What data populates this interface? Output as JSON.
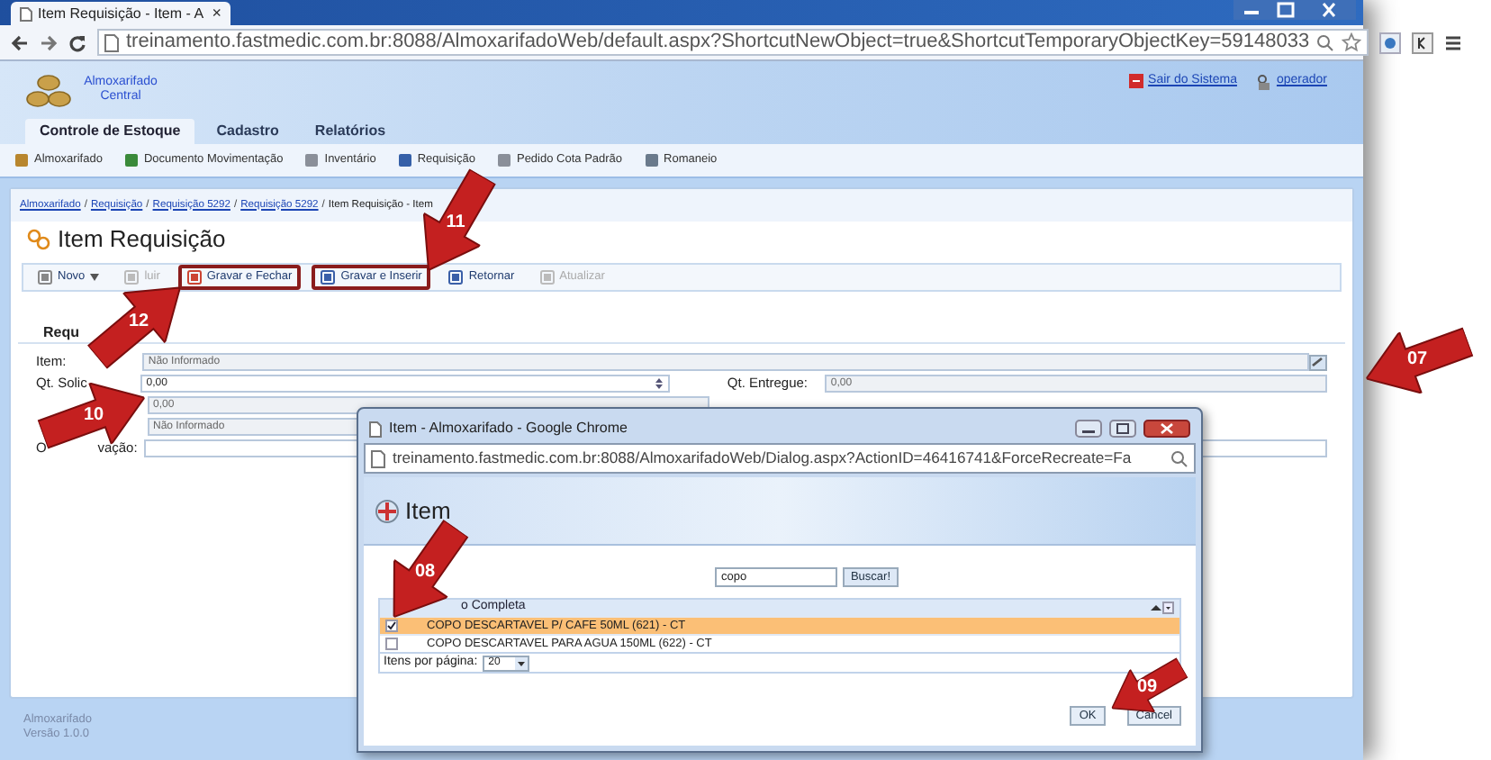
{
  "browser": {
    "tab_title": "Item Requisição - Item - A",
    "tab_close": "×",
    "url": "treinamento.fastmedic.com.br:8088/AlmoxarifadoWeb/default.aspx?ShortcutNewObject=true&ShortcutTemporaryObjectKey=59148033"
  },
  "header": {
    "logo_text": "Almoxarifado Central",
    "links": [
      "Sair do Sistema",
      "operador"
    ]
  },
  "tabs": [
    {
      "label": "Controle de Estoque",
      "selected": true
    },
    {
      "label": "Cadastro",
      "selected": false
    },
    {
      "label": "Relatórios",
      "selected": false
    }
  ],
  "submenu": [
    "Almoxarifado",
    "Documento Movimentação",
    "Inventário",
    "Requisição",
    "Pedido Cota Padrão",
    "Romaneio"
  ],
  "breadcrumb": [
    "Almoxarifado",
    "Requisição",
    "Requisição 5292",
    "Requisição 5292",
    "Item Requisição - Item"
  ],
  "breadcrumb_separators": [
    "/",
    "/",
    "/",
    "/"
  ],
  "page_title": "Item Requisição",
  "toolbar": [
    {
      "label": "Novo",
      "disabled": false,
      "highlighted": false
    },
    {
      "label": "luir",
      "disabled": true,
      "highlighted": false
    },
    {
      "label": "Gravar e Fechar",
      "disabled": false,
      "highlighted": true
    },
    {
      "label": "Gravar e Inserir",
      "disabled": false,
      "highlighted": true
    },
    {
      "label": "Retornar",
      "disabled": false,
      "highlighted": false
    },
    {
      "label": "Atualizar",
      "disabled": true,
      "highlighted": false
    }
  ],
  "section_title": "Requ",
  "form": [
    {
      "label": "Item:",
      "value": "Não Informado",
      "disabled": true
    },
    {
      "label": "Qt. Solic",
      "value": "0,00",
      "disabled": false
    },
    {
      "value": "0,00",
      "disabled": true
    },
    {
      "value": "Não Informado",
      "disabled": true
    },
    {
      "label_parts": [
        "O",
        "vação:"
      ],
      "disabled": false
    }
  ],
  "right_field": {
    "label": "Qt. Entregue:",
    "value": "0,00"
  },
  "footer": [
    "Almoxarifado",
    "Versão 1.0.0"
  ],
  "dialog": {
    "title": "Item - Almoxarifado - Google Chrome",
    "url": "treinamento.fastmedic.com.br:8088/AlmoxarifadoWeb/Dialog.aspx?ActionID=46416741&ForceRecreate=Fa",
    "heading": "Item",
    "search_value": "copo",
    "search_button": "Buscar!",
    "column": "o Completa",
    "rows": [
      {
        "text": "COPO DESCARTAVEL P/ CAFE 50ML (621) - CT",
        "selected": true
      },
      {
        "text": "COPO DESCARTAVEL PARA AGUA 150ML (622) - CT",
        "selected": false
      }
    ],
    "per_page_label": "Itens por página:",
    "per_page": "20",
    "buttons": [
      "OK",
      "Cancel"
    ]
  },
  "callouts": [
    "07",
    "08",
    "09",
    "10",
    "11",
    "12"
  ]
}
